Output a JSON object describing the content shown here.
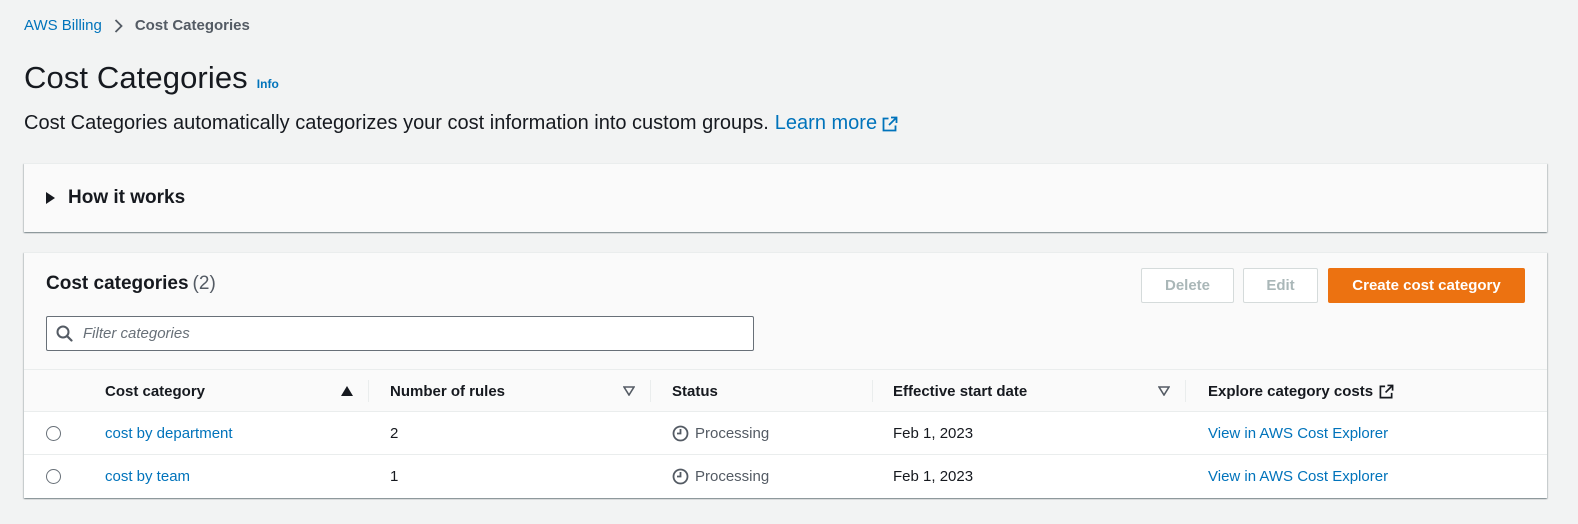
{
  "breadcrumb": {
    "root": "AWS Billing",
    "current": "Cost Categories"
  },
  "page": {
    "title": "Cost Categories",
    "info": "Info",
    "description": "Cost Categories automatically categorizes your cost information into custom groups.",
    "learn_more": "Learn more"
  },
  "how_it_works": {
    "label": "How it works"
  },
  "table": {
    "title": "Cost categories",
    "count": "(2)",
    "buttons": {
      "delete": "Delete",
      "edit": "Edit",
      "create": "Create cost category"
    },
    "filter_placeholder": "Filter categories",
    "columns": {
      "name": "Cost category",
      "rules": "Number of rules",
      "status": "Status",
      "start_date": "Effective start date",
      "explore": "Explore category costs"
    },
    "rows": [
      {
        "name": "cost by department",
        "rules": "2",
        "status": "Processing",
        "start_date": "Feb 1, 2023",
        "explore": "View in AWS Cost Explorer"
      },
      {
        "name": "cost by team",
        "rules": "1",
        "status": "Processing",
        "start_date": "Feb 1, 2023",
        "explore": "View in AWS Cost Explorer"
      }
    ]
  },
  "icons": {
    "breadcrumb_separator": "chevron-right-icon",
    "external_link": "external-link-icon",
    "expand": "caret-right-icon",
    "search": "search-icon",
    "sort_ascending": "sort-ascending-icon",
    "sort_descending": "sort-descending-icon",
    "status": "clock-icon"
  },
  "colors": {
    "link": "#0073bb",
    "primary_button": "#ec7211",
    "page_background": "#f2f3f3"
  }
}
